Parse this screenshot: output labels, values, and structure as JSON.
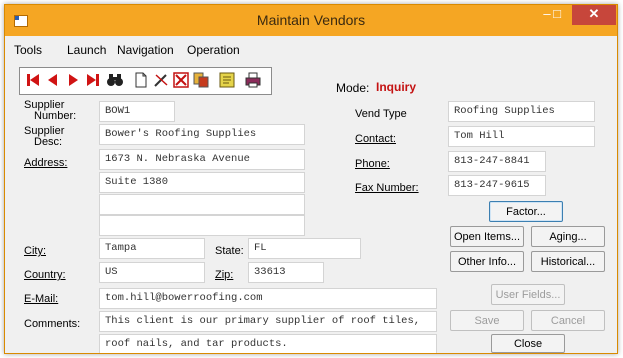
{
  "window": {
    "title": "Maintain Vendors",
    "minimize": "–",
    "maximize": "□",
    "close": "✕"
  },
  "menu": [
    "Tools",
    "Launch",
    "Navigation",
    "Operation"
  ],
  "toolbar": {
    "icons": [
      "first-record-icon",
      "previous-record-icon",
      "next-record-icon",
      "last-record-icon",
      "find-binoculars-icon",
      "new-document-icon",
      "edit-icon",
      "delete-icon",
      "copy-icon",
      "notes-icon",
      "print-icon"
    ]
  },
  "mode": {
    "label": "Mode:",
    "value": "Inquiry"
  },
  "left": {
    "supplier_number_label_1": "Supplier",
    "supplier_number_label_2": "Number:",
    "supplier_number": "BOW1",
    "supplier_desc_label_1": "Supplier",
    "supplier_desc_label_2": "Desc:",
    "supplier_desc": "Bower's Roofing Supplies",
    "address_label": "Address:",
    "address_1": "1673 N. Nebraska Avenue",
    "address_2": "Suite 1380",
    "address_3": "",
    "address_4": "",
    "city_label": "City:",
    "city": "Tampa",
    "state_label": "State:",
    "state": "FL",
    "country_label": "Country:",
    "country": "US",
    "zip_label": "Zip:",
    "zip": "33613",
    "email_label": "E-Mail:",
    "email": "tom.hill@bowerroofing.com",
    "comments_label": "Comments:",
    "comments_1": "This client is our primary supplier of roof tiles,",
    "comments_2": "roof nails, and tar products."
  },
  "right": {
    "vend_type_label": "Vend Type",
    "vend_type": "Roofing Supplies",
    "contact_label": "Contact:",
    "contact": "Tom Hill",
    "phone_label": "Phone:",
    "phone": "813-247-8841",
    "fax_label": "Fax Number:",
    "fax": "813-247-9615"
  },
  "buttons": {
    "factor": "Factor...",
    "open_items": "Open Items...",
    "aging": "Aging...",
    "other_info": "Other Info...",
    "historical": "Historical...",
    "user_fields": "User Fields...",
    "save": "Save",
    "cancel": "Cancel",
    "close": "Close"
  }
}
